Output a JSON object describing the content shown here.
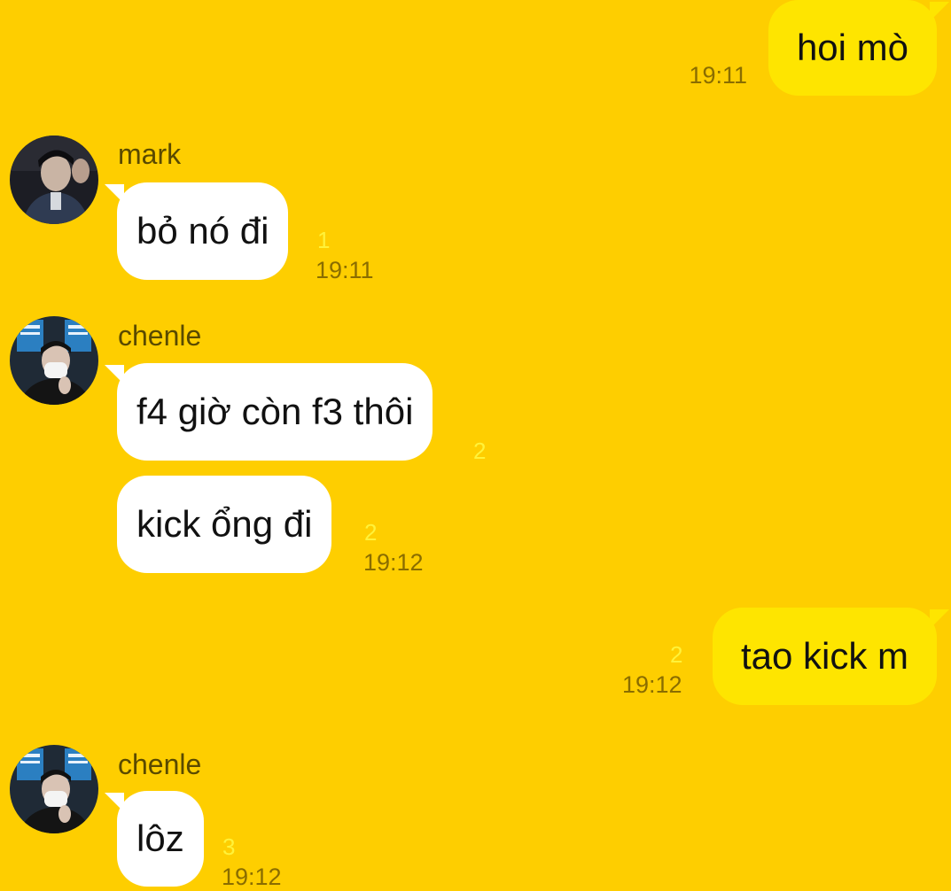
{
  "colors": {
    "background": "#FECE00",
    "incoming_bubble": "#FFFFFF",
    "outgoing_bubble": "#FEE500",
    "timestamp": "#8A6D00",
    "unread_count": "#FFF23A",
    "sender_name": "#5A4A00"
  },
  "messages": [
    {
      "direction": "out",
      "text": "hoi mò",
      "time": "19:11"
    },
    {
      "direction": "in",
      "sender": "mark",
      "avatar": "mark-avatar",
      "text": "bỏ nó đi",
      "unread": "1",
      "time": "19:11"
    },
    {
      "direction": "in",
      "sender": "chenle",
      "avatar": "chenle-avatar",
      "text": "f4 giờ còn f3 thôi",
      "unread": "2"
    },
    {
      "direction": "in",
      "text": "kick ổng đi",
      "unread": "2",
      "time": "19:12"
    },
    {
      "direction": "out",
      "text": "tao kick m",
      "unread": "2",
      "time": "19:12"
    },
    {
      "direction": "in",
      "sender": "chenle",
      "avatar": "chenle-avatar",
      "text": "lôz",
      "unread": "3",
      "time": "19:12"
    }
  ]
}
